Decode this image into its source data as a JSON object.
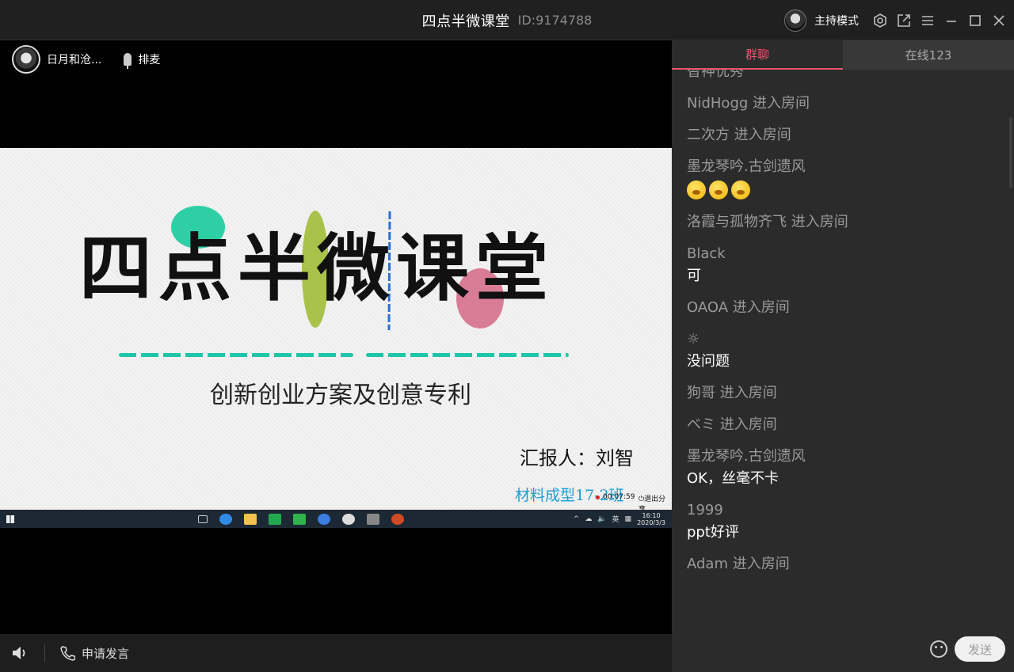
{
  "titlebar": {
    "title": "四点半微课堂",
    "room_id": "ID:9174788",
    "host_mode_label": "主持模式"
  },
  "stage": {
    "presenter_name": "日月和沧...",
    "queue_label": "排麦",
    "slide": {
      "title": "四点半微课堂",
      "subtitle": "创新创业方案及创意专利",
      "reporter": "汇报人：刘智",
      "class_text": "材料成型17-2班",
      "record_time": "00:07:59",
      "exit_share": "退出分享",
      "taskbar_ime": "英",
      "taskbar_time": "16:10",
      "taskbar_date": "2020/3/3"
    },
    "bottom": {
      "apply_speak": "申请发言"
    }
  },
  "panel": {
    "tabs": [
      {
        "label": "群聊",
        "active": true
      },
      {
        "label": "在线123",
        "active": false
      }
    ],
    "messages": [
      {
        "name": "智神优秀",
        "text": ""
      },
      {
        "name": "NidHogg 进入房间",
        "text": ""
      },
      {
        "name": "二次方     进入房间",
        "text": ""
      },
      {
        "name": "墨龙琴吟.古剑遗风",
        "text": "",
        "emojis": 3
      },
      {
        "name": "洛霞与孤物齐飞 进入房间",
        "text": ""
      },
      {
        "name": "Black",
        "text": "可"
      },
      {
        "name": "OAOA 进入房间",
        "text": ""
      },
      {
        "name": "☼",
        "text": "没问题"
      },
      {
        "name": "狗哥 进入房间",
        "text": ""
      },
      {
        "name": "ベミ 进入房间",
        "text": ""
      },
      {
        "name": "墨龙琴吟.古剑遗风",
        "text": "OK，丝毫不卡"
      },
      {
        "name": "1999",
        "text": "ppt好评"
      },
      {
        "name": "Adam 进入房间",
        "text": ""
      }
    ],
    "input_placeholder": "",
    "send_label": "发送"
  },
  "colors": {
    "accent": "#e8546d",
    "panel_bg": "#2b2b2b",
    "titlebar_bg": "#202020"
  }
}
